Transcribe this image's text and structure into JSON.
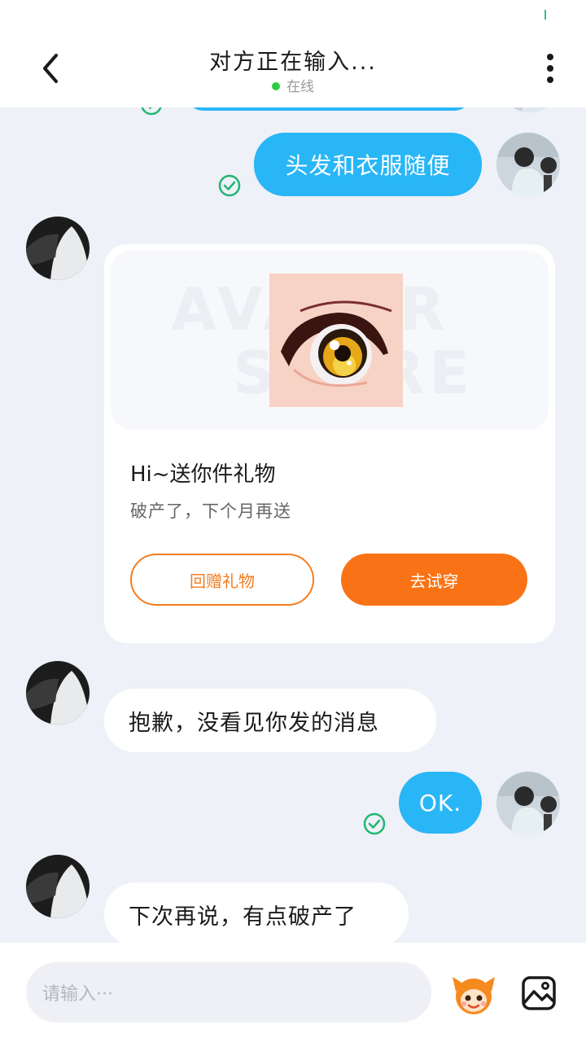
{
  "header": {
    "title": "对方正在输入...",
    "status": "在线"
  },
  "messages": [
    {
      "type": "text",
      "from": "me",
      "text": "头发和衣服随便",
      "read": true
    },
    {
      "type": "gift",
      "from": "other",
      "watermark_top": "AVATAR",
      "watermark_bottom": "STORE",
      "title": "Hi~送你件礼物",
      "subtitle": "破产了，下个月再送",
      "return_button": "回赠礼物",
      "try_button": "去试穿"
    },
    {
      "type": "text",
      "from": "other",
      "text": "抱歉，没看见你发的消息"
    },
    {
      "type": "text",
      "from": "me",
      "text": "OK.",
      "read": true
    },
    {
      "type": "text",
      "from": "other",
      "text": "下次再说，有点破产了"
    }
  ],
  "composer": {
    "placeholder": "请输入···"
  },
  "colors": {
    "accent_blue": "#29b6f6",
    "accent_orange": "#f97316",
    "online_green": "#2ecc40",
    "read_green": "#22b573"
  },
  "icons": [
    "back-arrow-icon",
    "more-vertical-icon",
    "read-check-icon",
    "mascot-emoji-icon",
    "image-icon"
  ]
}
